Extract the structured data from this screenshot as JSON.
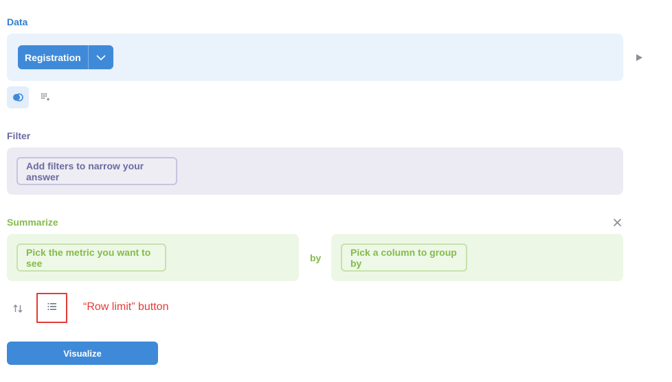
{
  "data_section": {
    "label": "Data",
    "table_button": "Registration",
    "icons": [
      "chevron-down-icon",
      "play-triangle-icon",
      "join-icon",
      "custom-column-icon"
    ]
  },
  "filter_section": {
    "label": "Filter",
    "add_filter_button": "Add filters to narrow your answer"
  },
  "summarize_section": {
    "label": "Summarize",
    "metric_button": "Pick the metric you want to see",
    "by_label": "by",
    "group_button": "Pick a column to group by",
    "icons": [
      "close-icon"
    ]
  },
  "actions": {
    "icons": [
      "sort-icon",
      "row-limit-icon"
    ]
  },
  "annotation": {
    "text": "“Row limit” button",
    "color": "#e53935"
  },
  "visualize_button": "Visualize",
  "colors": {
    "data": "#2f7fd0",
    "filter": "#6b6aa0",
    "summarize": "#84bb4c",
    "primary_button": "#3f8ad8"
  }
}
